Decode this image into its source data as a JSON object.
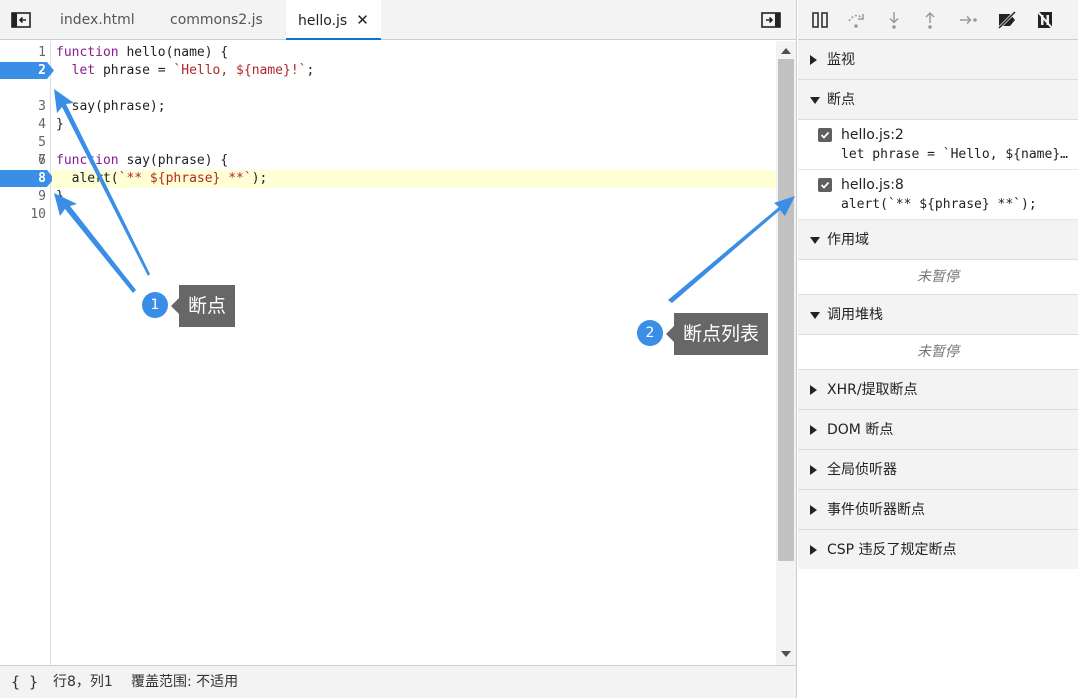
{
  "tabs": [
    {
      "label": "index.html"
    },
    {
      "label": "commons2.js"
    },
    {
      "label": "hello.js",
      "close": "✕",
      "active": true
    }
  ],
  "editor": {
    "line_numbers": [
      "1",
      "2",
      "3",
      "4",
      "5",
      "6",
      "7",
      "8",
      "9",
      "10"
    ],
    "breakpoint_lines": [
      "2",
      "8"
    ],
    "highlighted_line": "8",
    "code": [
      {
        "pre": "",
        "kw": "function",
        "rest": " hello(name) {"
      },
      {
        "pre": "  ",
        "kw": "let",
        "rest": " phrase = ",
        "str": "`Hello, ${name}!`",
        "tail": ";"
      },
      {
        "pre": "",
        "kw": "",
        "rest": ""
      },
      {
        "pre": "  ",
        "kw": "",
        "rest": "say(phrase);"
      },
      {
        "pre": "",
        "kw": "",
        "rest": "}"
      },
      {
        "pre": "",
        "kw": "",
        "rest": ""
      },
      {
        "pre": "",
        "kw": "function",
        "rest": " say(phrase) {"
      },
      {
        "pre": "  ",
        "kw": "",
        "rest": "alert(",
        "str": "`** ${phrase} **`",
        "tail": ");"
      },
      {
        "pre": "",
        "kw": "",
        "rest": "}"
      },
      {
        "pre": "",
        "kw": "",
        "rest": ""
      }
    ]
  },
  "status": {
    "format_button": "{ }",
    "cursor_position": "行8，列1",
    "coverage": "覆盖范围: 不适用"
  },
  "annotations": [
    {
      "number": "1",
      "label": "断点"
    },
    {
      "number": "2",
      "label": "断点列表"
    }
  ],
  "debugger": {
    "toolbar_icons": [
      "pause-icon",
      "step-over-icon",
      "step-into-icon",
      "step-out-icon",
      "step-icon",
      "deactivate-breakpoints-icon",
      "pause-on-exceptions-icon"
    ],
    "sections": {
      "watch": "监视",
      "breakpoints": "断点",
      "scope": "作用域",
      "call_stack": "调用堆栈",
      "xhr": "XHR/提取断点",
      "dom": "DOM 断点",
      "global_listeners": "全局侦听器",
      "event_listener_breakpoints": "事件侦听器断点",
      "csp": "CSP 违反了规定断点"
    },
    "breakpoints": [
      {
        "file": "hello.js:2",
        "code": "let phrase = `Hello, ${name}!`;",
        "checked": true
      },
      {
        "file": "hello.js:8",
        "code": "alert(`** ${phrase} **`);",
        "checked": true
      }
    ],
    "not_paused": "未暂停"
  },
  "colors": {
    "breakpoint": "#3a8ee6",
    "highlight": "#ffffd6",
    "callout": "#676767",
    "active_tab_underline": "#0a73d8"
  }
}
